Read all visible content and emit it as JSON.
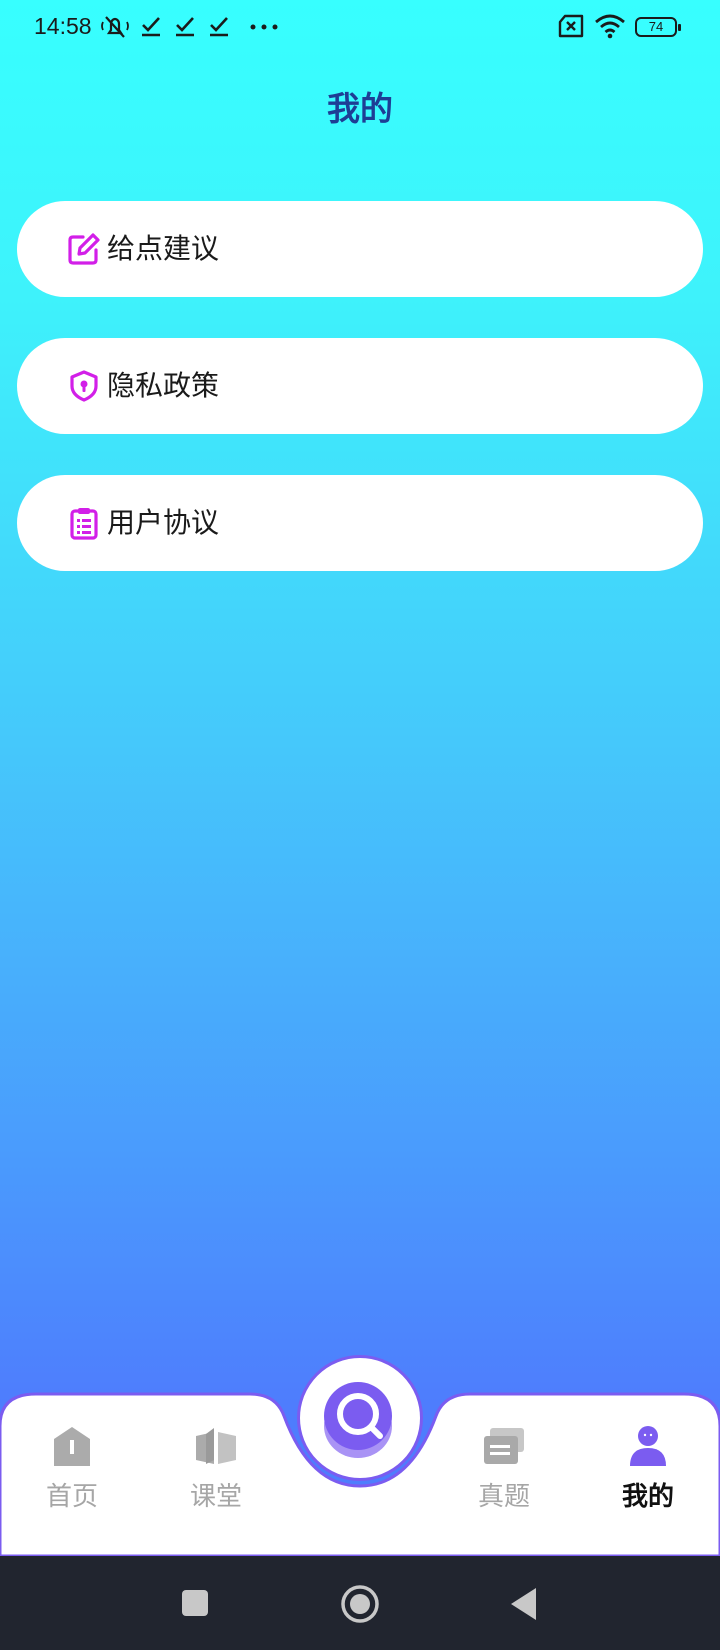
{
  "status_bar": {
    "time": "14:58",
    "battery": "74",
    "icons": [
      "mute-icon",
      "download-done-icon",
      "download-done-icon",
      "download-done-icon",
      "more-dots-icon",
      "no-sim-icon",
      "wifi-icon",
      "battery-icon"
    ]
  },
  "header": {
    "title": "我的"
  },
  "menu": {
    "items": [
      {
        "label": "给点建议",
        "icon": "edit-icon"
      },
      {
        "label": "隐私政策",
        "icon": "shield-lock-icon"
      },
      {
        "label": "用户协议",
        "icon": "clipboard-list-icon"
      }
    ]
  },
  "tabbar": {
    "tabs": [
      {
        "label": "首页",
        "icon": "home-icon",
        "active": false
      },
      {
        "label": "课堂",
        "icon": "book-icon",
        "active": false
      },
      {
        "label": "真题",
        "icon": "cards-icon",
        "active": false
      },
      {
        "label": "我的",
        "icon": "user-icon",
        "active": true
      }
    ],
    "center_icon": "search-icon"
  },
  "colors": {
    "accent": "#d21fe8",
    "title": "#1e3e95",
    "active_tab": "#7b5cf0",
    "inactive_tab": "#a6a6a6"
  }
}
